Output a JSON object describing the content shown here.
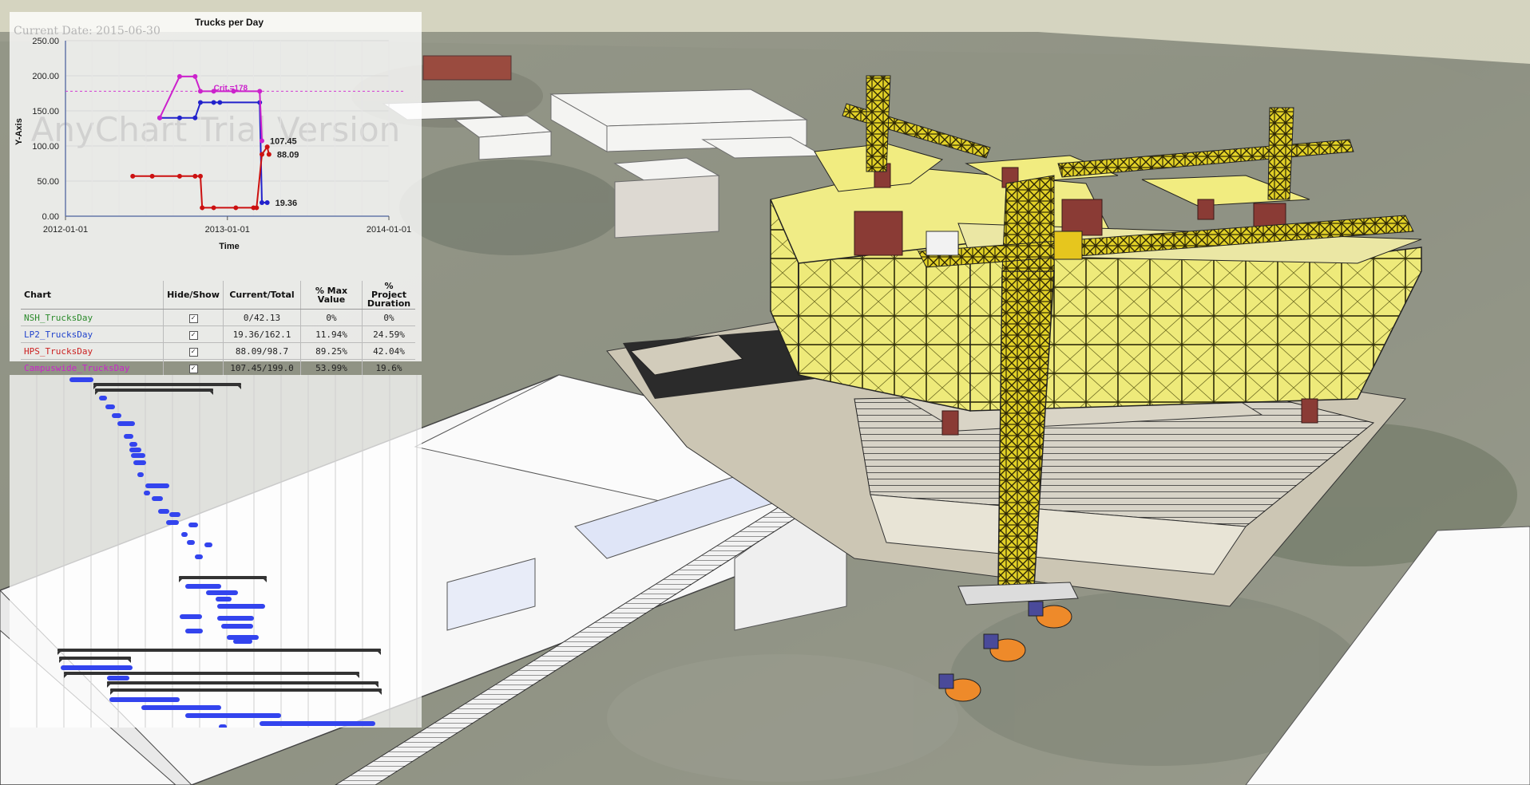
{
  "header": {
    "current_date": "Current Date: 2015-06-30",
    "watermark": "AnyChart Trial Version"
  },
  "chart_data": {
    "type": "line",
    "title": "Trucks per Day",
    "xlabel": "Time",
    "ylabel": "Y-Axis",
    "x_ticks": [
      "2012-01-01",
      "2013-01-01",
      "2014-01-01"
    ],
    "y_ticks": [
      "0.00",
      "50.00",
      "100.00",
      "150.00",
      "200.00",
      "250.00"
    ],
    "xlim": [
      "2012-01-01",
      "2014-01-01"
    ],
    "ylim": [
      0,
      250
    ],
    "grid": true,
    "threshold": {
      "label": "Crit.=178",
      "value": 178
    },
    "series": [
      {
        "name": "LP2_TrucksDay",
        "color": "#2222cc",
        "points": [
          [
            "2012-08-01",
            140
          ],
          [
            "2012-09-15",
            140
          ],
          [
            "2012-10-20",
            140
          ],
          [
            "2012-11-01",
            162
          ],
          [
            "2012-12-01",
            162
          ],
          [
            "2012-12-15",
            162
          ],
          [
            "2013-03-15",
            162
          ],
          [
            "2013-03-20",
            19.36
          ],
          [
            "2013-04-01",
            19.36
          ]
        ]
      },
      {
        "name": "HPS_TrucksDay",
        "color": "#cc1111",
        "points": [
          [
            "2012-06-01",
            57
          ],
          [
            "2012-07-15",
            57
          ],
          [
            "2012-09-15",
            57
          ],
          [
            "2012-10-20",
            57
          ],
          [
            "2012-11-01",
            57
          ],
          [
            "2012-11-05",
            12
          ],
          [
            "2012-12-01",
            12
          ],
          [
            "2013-01-20",
            12
          ],
          [
            "2013-03-01",
            12
          ],
          [
            "2013-03-08",
            12
          ],
          [
            "2013-03-20",
            88
          ],
          [
            "2013-04-01",
            98.7
          ],
          [
            "2013-04-05",
            88.09
          ]
        ]
      },
      {
        "name": "Campuswide_TrucksDay",
        "color": "#cc22cc",
        "points": [
          [
            "2012-08-01",
            140
          ],
          [
            "2012-09-15",
            199
          ],
          [
            "2012-10-20",
            199
          ],
          [
            "2012-11-01",
            178
          ],
          [
            "2012-12-01",
            178
          ],
          [
            "2013-01-15",
            178
          ],
          [
            "2013-03-15",
            178
          ],
          [
            "2013-03-20",
            107.45
          ]
        ]
      }
    ],
    "point_labels": [
      "107.45",
      "88.09",
      "19.36"
    ]
  },
  "legend_table": {
    "headers": [
      "Chart",
      "Hide/Show",
      "Current/Total",
      "% Max Value",
      "% Project Duration"
    ],
    "rows": [
      {
        "name": "NSH_TrucksDay",
        "color": "#2a8a2a",
        "checked": "✓",
        "current_total": "0/42.13",
        "max_value": "0%",
        "duration": "0%"
      },
      {
        "name": "LP2_TrucksDay",
        "color": "#2244cc",
        "checked": "✓",
        "current_total": "19.36/162.1",
        "max_value": "11.94%",
        "duration": "24.59%"
      },
      {
        "name": "HPS_TrucksDay",
        "color": "#cc2222",
        "checked": "✓",
        "current_total": "88.09/98.7",
        "max_value": "89.25%",
        "duration": "42.04%"
      },
      {
        "name": "Campuswide_TrucksDay",
        "color": "#cc22cc",
        "checked": "✓",
        "current_total": "107.45/199.0",
        "max_value": "53.99%",
        "duration": "19.6%"
      }
    ]
  },
  "gantt": {
    "colors": {
      "task": "#3344ee",
      "summary": "#333333"
    }
  }
}
